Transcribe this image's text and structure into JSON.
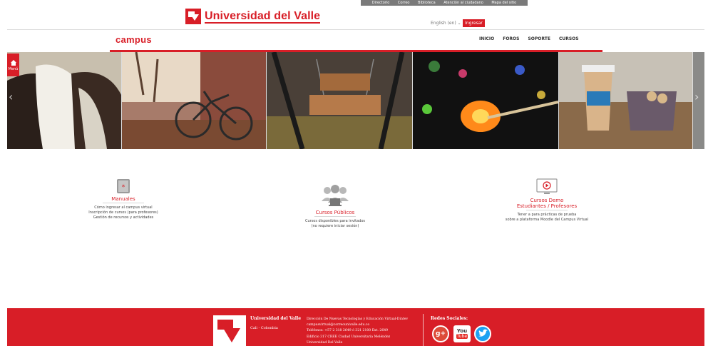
{
  "topbar": {
    "links": [
      "Directorio",
      "Correo",
      "Biblioteca",
      "Atención al ciudadano",
      "Mapa del sitio"
    ]
  },
  "header": {
    "logo_text": "Universidad del Valle",
    "language": "English (en) ⌄",
    "login_label": "Ingresar"
  },
  "site": {
    "title": "campus",
    "nav": [
      "INICIO",
      "FOROS",
      "SOPORTE",
      "CURSOS"
    ]
  },
  "carousel": {
    "menu_label": "Menú",
    "slides": [
      "horses",
      "bicycle",
      "swing",
      "match",
      "coffee"
    ]
  },
  "features": [
    {
      "title": "Manuales",
      "icon": "manual-book-icon",
      "lines": [
        "Cómo ingresar al campus virtual",
        "Inscripción de cursos (para profesores)",
        "Gestión de recursos y actividades"
      ]
    },
    {
      "title": "Cursos Públicos",
      "icon": "users-group-icon",
      "lines": [
        "Cursos disponibles para invitados",
        "(no requiere iniciar sesión)"
      ]
    },
    {
      "title": "Cursos Demo",
      "subtitle": "Estudiantes / Profesores",
      "icon": "play-monitor-icon",
      "lines": [
        "Tener a para prácticas de prueba",
        "sobre a plataforma Moodle del Campus Virtual"
      ]
    }
  ],
  "footer": {
    "university": "Universidad del Valle",
    "city": "Cali - Colombia",
    "info_lines": [
      "Dirección De Nuevas Tecnologías y Educación Virtual-Dintev",
      "campusvirtual@correounivalle.edu.co",
      "Teléfonos: +57 2 318 2649 ó 321 2100 Ext. 2649",
      "Edificio 317 CREE Ciudad Universitaria Meléndez",
      "Universidad Del Valle"
    ],
    "social_title": "Redes Sociales:",
    "social": [
      "g+",
      "You",
      "Tube"
    ]
  },
  "colors": {
    "brand_red": "#d81e27",
    "topbar_grey": "#7a7a7a"
  }
}
